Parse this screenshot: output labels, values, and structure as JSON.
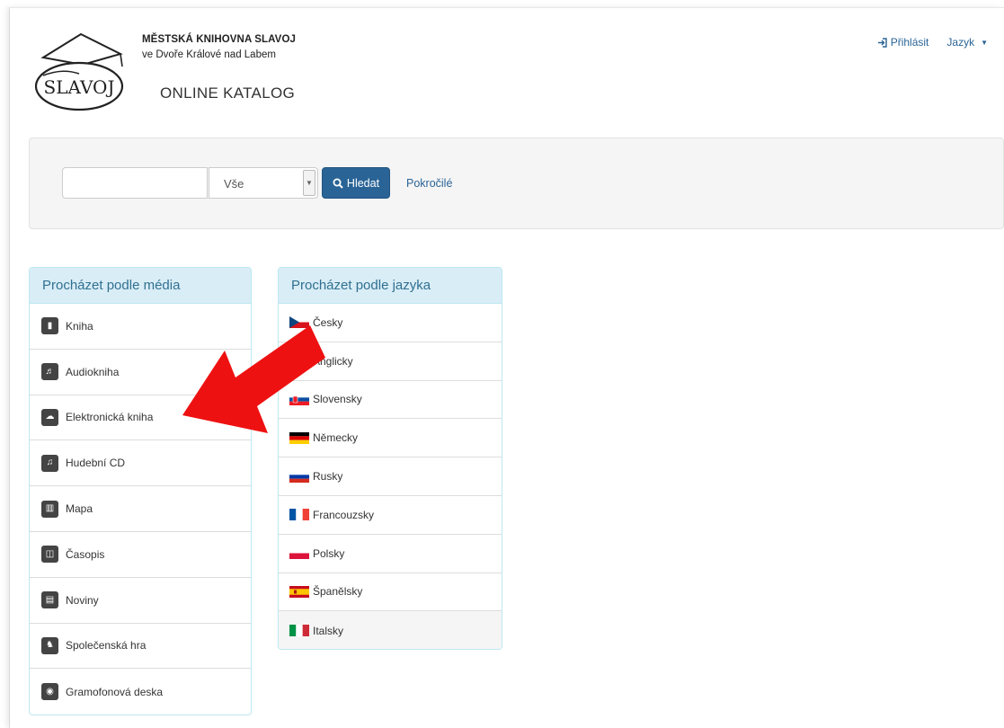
{
  "header": {
    "brand_name": "MĚSTSKÁ KNIHOVNA SLAVOJ",
    "brand_sub": "ve Dvoře Králové nad Labem",
    "catalog_title": "ONLINE KATALOG",
    "logo_text": "SLAVOJ",
    "login_label": "Přihlásit",
    "language_label": "Jazyk"
  },
  "search": {
    "input_value": "",
    "type_selected": "Vše",
    "search_label": "Hledat",
    "advanced_label": "Pokročilé"
  },
  "media_panel": {
    "title": "Procházet podle média",
    "items": [
      {
        "label": "Kniha",
        "icon": "book-icon"
      },
      {
        "label": "Audiokniha",
        "icon": "volume-icon"
      },
      {
        "label": "Elektronická kniha",
        "icon": "cloud-download-icon"
      },
      {
        "label": "Hudební CD",
        "icon": "music-icon"
      },
      {
        "label": "Mapa",
        "icon": "map-icon"
      },
      {
        "label": "Časopis",
        "icon": "magazine-icon"
      },
      {
        "label": "Noviny",
        "icon": "newspaper-icon"
      },
      {
        "label": "Společenská hra",
        "icon": "puzzle-icon"
      },
      {
        "label": "Gramofonová deska",
        "icon": "vinyl-record-icon"
      }
    ]
  },
  "language_panel": {
    "title": "Procházet podle jazyka",
    "items": [
      {
        "label": "Česky",
        "flag": "cz"
      },
      {
        "label": "Anglicky",
        "flag": "gb"
      },
      {
        "label": "Slovensky",
        "flag": "sk"
      },
      {
        "label": "Německy",
        "flag": "de"
      },
      {
        "label": "Rusky",
        "flag": "ru"
      },
      {
        "label": "Francouzsky",
        "flag": "fr"
      },
      {
        "label": "Polsky",
        "flag": "pl"
      },
      {
        "label": "Španělsky",
        "flag": "es"
      },
      {
        "label": "Italsky",
        "flag": "it"
      }
    ]
  },
  "colors": {
    "primary": "#2a6496",
    "panel_heading_bg": "#d9edf7",
    "panel_heading_text": "#31708f",
    "annotation_arrow": "#ee1111"
  }
}
